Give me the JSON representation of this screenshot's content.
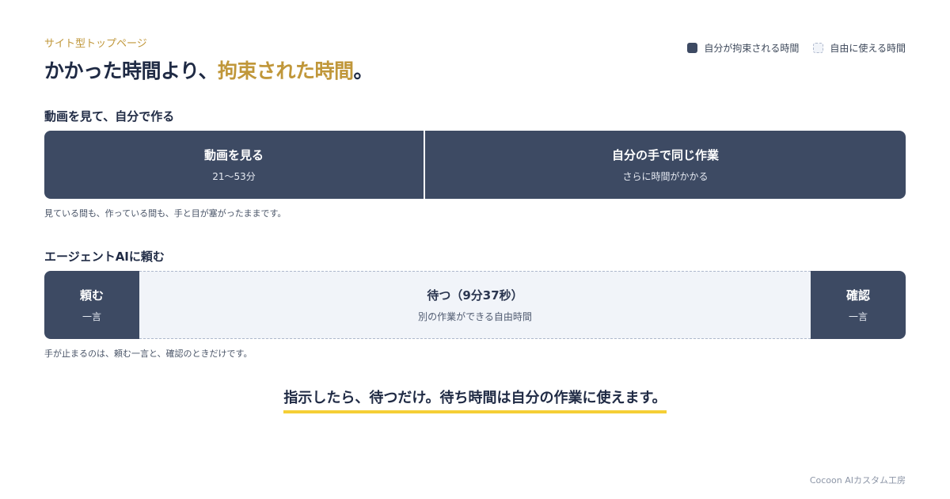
{
  "header": {
    "eyebrow": "サイト型トップページ",
    "headline_prefix": "かかった時間より、",
    "headline_accent": "拘束された時間",
    "headline_suffix": "。"
  },
  "legend": {
    "bound_label": "自分が拘束される時間",
    "free_label": "自由に使える時間"
  },
  "section_video": {
    "title": "動画を見て、自分で作る",
    "segments": [
      {
        "label": "動画を見る",
        "sub": "21〜53分"
      },
      {
        "label": "自分の手で同じ作業",
        "sub": "さらに時間がかかる"
      }
    ],
    "note": "見ている間も、作っている間も、手と目が塞がったままです。"
  },
  "section_agent": {
    "title": "エージェントAIに頼む",
    "segments": [
      {
        "label": "頼む",
        "sub": "一言"
      },
      {
        "label": "待つ（9分37秒）",
        "sub": "別の作業ができる自由時間"
      },
      {
        "label": "確認",
        "sub": "一言"
      }
    ],
    "note": "手が止まるのは、頼む一言と、確認のときだけです。"
  },
  "tagline": "指示したら、待つだけ。待ち時間は自分の作業に使えます。",
  "brand": "Cocoon AIカスタム工房",
  "colors": {
    "accent": "#c0973a",
    "bound": "#3d4a63",
    "free": "#f1f4f9",
    "underline": "#f5cf36"
  }
}
